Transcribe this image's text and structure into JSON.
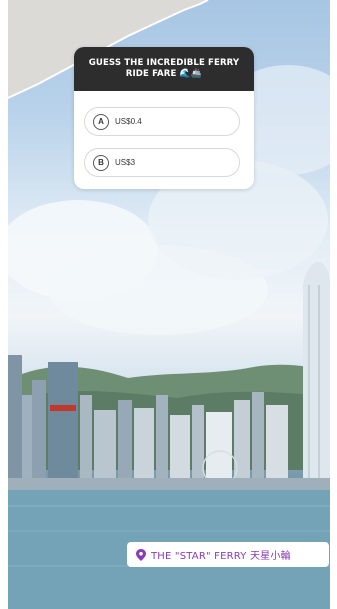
{
  "quiz": {
    "question": "GUESS THE INCREDIBLE FERRY RIDE FARE",
    "question_emoji": "🌊🚢",
    "options": [
      {
        "letter": "A",
        "text": "US$0.4"
      },
      {
        "letter": "B",
        "text": "US$3"
      }
    ]
  },
  "location": {
    "label": "THE \"STAR\" FERRY  天星小輪",
    "icon": "location-pin-icon",
    "color": "#8a3ab9"
  }
}
